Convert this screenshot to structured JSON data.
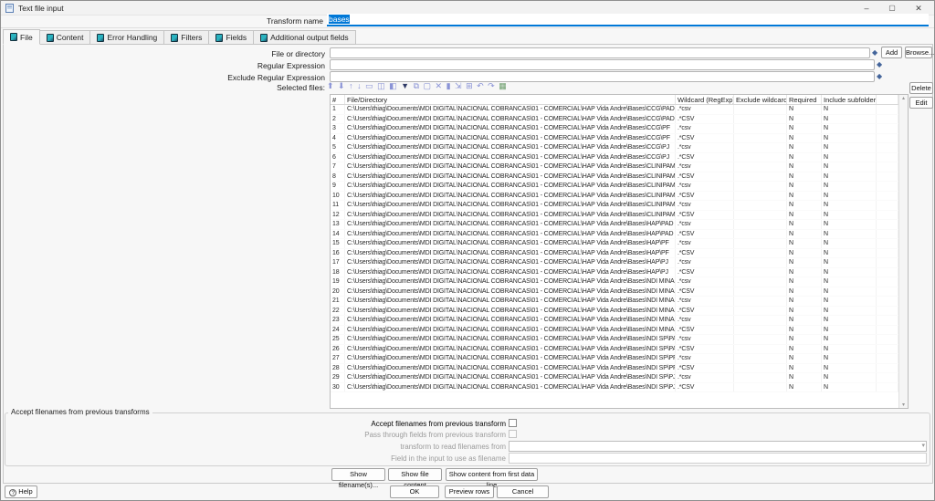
{
  "window": {
    "title": "Text file input",
    "minimize_glyph": "–",
    "maximize_glyph": "▢",
    "close_glyph": "✕"
  },
  "header": {
    "transform_name_label": "Transform name",
    "transform_name_value": "bases"
  },
  "tabs": [
    {
      "label": "File",
      "active": true
    },
    {
      "label": "Content",
      "active": false
    },
    {
      "label": "Error Handling",
      "active": false
    },
    {
      "label": "Filters",
      "active": false
    },
    {
      "label": "Fields",
      "active": false
    },
    {
      "label": "Additional output fields",
      "active": false
    }
  ],
  "file_tab": {
    "file_or_directory_label": "File or directory",
    "regular_expression_label": "Regular Expression",
    "exclude_regular_expression_label": "Exclude Regular Expression",
    "selected_files_label": "Selected files:",
    "add_button": "Add",
    "browse_button": "Browse...",
    "delete_button": "Delete",
    "edit_button": "Edit"
  },
  "toolbar": {
    "icons": [
      {
        "name": "sort-ascending-icon",
        "glyph": "⬆"
      },
      {
        "name": "sort-descending-icon",
        "glyph": "⬇"
      },
      {
        "name": "move-rows-up-icon",
        "glyph": "↑"
      },
      {
        "name": "move-rows-down-icon",
        "glyph": "↓"
      },
      {
        "name": "clear-rows-icon",
        "glyph": "▭"
      },
      {
        "name": "optimal-width-with-header-icon",
        "glyph": "◫"
      },
      {
        "name": "optimal-width-without-header-icon",
        "glyph": "◧"
      },
      {
        "name": "filter-rows-icon",
        "glyph": "▼",
        "color": "#2f3a66"
      },
      {
        "name": "copy-rows-icon",
        "glyph": "⧉"
      },
      {
        "name": "paste-rows-icon",
        "glyph": "▢"
      },
      {
        "name": "cut-rows-icon",
        "glyph": "✕"
      },
      {
        "name": "delete-rows-icon",
        "glyph": "▮"
      },
      {
        "name": "keep-selected-rows-icon",
        "glyph": "⇲"
      },
      {
        "name": "copy-field-to-all-rows-icon",
        "glyph": "⊞"
      },
      {
        "name": "undo-icon",
        "glyph": "↶"
      },
      {
        "name": "redo-icon",
        "glyph": "↷"
      },
      {
        "name": "edit-row-icon",
        "glyph": "▦",
        "color": "#6f9f6f"
      }
    ]
  },
  "table": {
    "columns": [
      "#",
      "File/Directory",
      "Wildcard (RegExp)",
      "Exclude wildcard",
      "Required",
      "Include subfolders"
    ],
    "rows": [
      [
        1,
        "C:\\Users\\thiag\\Documents\\MDI DIGITAL\\NACIONAL COBRANCAS\\01 - COMERCIAL\\HAP Vida Andre\\Bases\\CCG\\PAD",
        ".*csv",
        "",
        "N",
        "N"
      ],
      [
        2,
        "C:\\Users\\thiag\\Documents\\MDI DIGITAL\\NACIONAL COBRANCAS\\01 - COMERCIAL\\HAP Vida Andre\\Bases\\CCG\\PAD",
        ".*CSV",
        "",
        "N",
        "N"
      ],
      [
        3,
        "C:\\Users\\thiag\\Documents\\MDI DIGITAL\\NACIONAL COBRANCAS\\01 - COMERCIAL\\HAP Vida Andre\\Bases\\CCG\\PF",
        ".*csv",
        "",
        "N",
        "N"
      ],
      [
        4,
        "C:\\Users\\thiag\\Documents\\MDI DIGITAL\\NACIONAL COBRANCAS\\01 - COMERCIAL\\HAP Vida Andre\\Bases\\CCG\\PF",
        ".*CSV",
        "",
        "N",
        "N"
      ],
      [
        5,
        "C:\\Users\\thiag\\Documents\\MDI DIGITAL\\NACIONAL COBRANCAS\\01 - COMERCIAL\\HAP Vida Andre\\Bases\\CCG\\PJ",
        ".*csv",
        "",
        "N",
        "N"
      ],
      [
        6,
        "C:\\Users\\thiag\\Documents\\MDI DIGITAL\\NACIONAL COBRANCAS\\01 - COMERCIAL\\HAP Vida Andre\\Bases\\CCG\\PJ",
        ".*CSV",
        "",
        "N",
        "N"
      ],
      [
        7,
        "C:\\Users\\thiag\\Documents\\MDI DIGITAL\\NACIONAL COBRANCAS\\01 - COMERCIAL\\HAP Vida Andre\\Bases\\CLINIPAM\\PAD",
        ".*csv",
        "",
        "N",
        "N"
      ],
      [
        8,
        "C:\\Users\\thiag\\Documents\\MDI DIGITAL\\NACIONAL COBRANCAS\\01 - COMERCIAL\\HAP Vida Andre\\Bases\\CLINIPAM\\PAD",
        ".*CSV",
        "",
        "N",
        "N"
      ],
      [
        9,
        "C:\\Users\\thiag\\Documents\\MDI DIGITAL\\NACIONAL COBRANCAS\\01 - COMERCIAL\\HAP Vida Andre\\Bases\\CLINIPAM\\PF",
        ".*csv",
        "",
        "N",
        "N"
      ],
      [
        10,
        "C:\\Users\\thiag\\Documents\\MDI DIGITAL\\NACIONAL COBRANCAS\\01 - COMERCIAL\\HAP Vida Andre\\Bases\\CLINIPAM\\PF",
        ".*CSV",
        "",
        "N",
        "N"
      ],
      [
        11,
        "C:\\Users\\thiag\\Documents\\MDI DIGITAL\\NACIONAL COBRANCAS\\01 - COMERCIAL\\HAP Vida Andre\\Bases\\CLINIPAM\\PJ",
        ".*csv",
        "",
        "N",
        "N"
      ],
      [
        12,
        "C:\\Users\\thiag\\Documents\\MDI DIGITAL\\NACIONAL COBRANCAS\\01 - COMERCIAL\\HAP Vida Andre\\Bases\\CLINIPAM\\PJ",
        ".*CSV",
        "",
        "N",
        "N"
      ],
      [
        13,
        "C:\\Users\\thiag\\Documents\\MDI DIGITAL\\NACIONAL COBRANCAS\\01 - COMERCIAL\\HAP Vida Andre\\Bases\\HAP\\PAD",
        ".*csv",
        "",
        "N",
        "N"
      ],
      [
        14,
        "C:\\Users\\thiag\\Documents\\MDI DIGITAL\\NACIONAL COBRANCAS\\01 - COMERCIAL\\HAP Vida Andre\\Bases\\HAP\\PAD",
        ".*CSV",
        "",
        "N",
        "N"
      ],
      [
        15,
        "C:\\Users\\thiag\\Documents\\MDI DIGITAL\\NACIONAL COBRANCAS\\01 - COMERCIAL\\HAP Vida Andre\\Bases\\HAP\\PF",
        ".*csv",
        "",
        "N",
        "N"
      ],
      [
        16,
        "C:\\Users\\thiag\\Documents\\MDI DIGITAL\\NACIONAL COBRANCAS\\01 - COMERCIAL\\HAP Vida Andre\\Bases\\HAP\\PF",
        ".*CSV",
        "",
        "N",
        "N"
      ],
      [
        17,
        "C:\\Users\\thiag\\Documents\\MDI DIGITAL\\NACIONAL COBRANCAS\\01 - COMERCIAL\\HAP Vida Andre\\Bases\\HAP\\PJ",
        ".*csv",
        "",
        "N",
        "N"
      ],
      [
        18,
        "C:\\Users\\thiag\\Documents\\MDI DIGITAL\\NACIONAL COBRANCAS\\01 - COMERCIAL\\HAP Vida Andre\\Bases\\HAP\\PJ",
        ".*CSV",
        "",
        "N",
        "N"
      ],
      [
        19,
        "C:\\Users\\thiag\\Documents\\MDI DIGITAL\\NACIONAL COBRANCAS\\01 - COMERCIAL\\HAP Vida Andre\\Bases\\NDI MINAS\\PAD",
        ".*csv",
        "",
        "N",
        "N"
      ],
      [
        20,
        "C:\\Users\\thiag\\Documents\\MDI DIGITAL\\NACIONAL COBRANCAS\\01 - COMERCIAL\\HAP Vida Andre\\Bases\\NDI MINAS\\PAD",
        ".*CSV",
        "",
        "N",
        "N"
      ],
      [
        21,
        "C:\\Users\\thiag\\Documents\\MDI DIGITAL\\NACIONAL COBRANCAS\\01 - COMERCIAL\\HAP Vida Andre\\Bases\\NDI MINAS\\PF",
        ".*csv",
        "",
        "N",
        "N"
      ],
      [
        22,
        "C:\\Users\\thiag\\Documents\\MDI DIGITAL\\NACIONAL COBRANCAS\\01 - COMERCIAL\\HAP Vida Andre\\Bases\\NDI MINAS\\PF",
        ".*CSV",
        "",
        "N",
        "N"
      ],
      [
        23,
        "C:\\Users\\thiag\\Documents\\MDI DIGITAL\\NACIONAL COBRANCAS\\01 - COMERCIAL\\HAP Vida Andre\\Bases\\NDI MINAS\\PJ",
        ".*csv",
        "",
        "N",
        "N"
      ],
      [
        24,
        "C:\\Users\\thiag\\Documents\\MDI DIGITAL\\NACIONAL COBRANCAS\\01 - COMERCIAL\\HAP Vida Andre\\Bases\\NDI MINAS\\PJ",
        ".*CSV",
        "",
        "N",
        "N"
      ],
      [
        25,
        "C:\\Users\\thiag\\Documents\\MDI DIGITAL\\NACIONAL COBRANCAS\\01 - COMERCIAL\\HAP Vida Andre\\Bases\\NDI SP\\PAD",
        ".*csv",
        "",
        "N",
        "N"
      ],
      [
        26,
        "C:\\Users\\thiag\\Documents\\MDI DIGITAL\\NACIONAL COBRANCAS\\01 - COMERCIAL\\HAP Vida Andre\\Bases\\NDI SP\\PAD",
        ".*CSV",
        "",
        "N",
        "N"
      ],
      [
        27,
        "C:\\Users\\thiag\\Documents\\MDI DIGITAL\\NACIONAL COBRANCAS\\01 - COMERCIAL\\HAP Vida Andre\\Bases\\NDI SP\\PF",
        ".*csv",
        "",
        "N",
        "N"
      ],
      [
        28,
        "C:\\Users\\thiag\\Documents\\MDI DIGITAL\\NACIONAL COBRANCAS\\01 - COMERCIAL\\HAP Vida Andre\\Bases\\NDI SP\\PF",
        ".*CSV",
        "",
        "N",
        "N"
      ],
      [
        29,
        "C:\\Users\\thiag\\Documents\\MDI DIGITAL\\NACIONAL COBRANCAS\\01 - COMERCIAL\\HAP Vida Andre\\Bases\\NDI SP\\PJ",
        ".*csv",
        "",
        "N",
        "N"
      ],
      [
        30,
        "C:\\Users\\thiag\\Documents\\MDI DIGITAL\\NACIONAL COBRANCAS\\01 - COMERCIAL\\HAP Vida Andre\\Bases\\NDI SP\\PJ",
        ".*CSV",
        "",
        "N",
        "N"
      ]
    ]
  },
  "accept_group": {
    "legend": "Accept filenames from previous transforms",
    "accept_label": "Accept filenames from previous transform",
    "pass_through_label": "Pass through fields from previous transform",
    "transform_read_label": "transform to read filenames from",
    "field_input_label": "Field in the input to use as filename"
  },
  "footer": {
    "show_filenames_button": "Show filename(s)...",
    "show_file_content_button": "Show file content",
    "show_first_line_button": "Show content from first data line",
    "help_button": "Help",
    "ok_button": "OK",
    "preview_rows_button": "Preview rows",
    "cancel_button": "Cancel"
  },
  "colors": {
    "selection": "#0078d7",
    "focus_underline": "#0078d7",
    "tab_icon_teal": "#2bb3c0",
    "toolbar_icon": "#8a93d6",
    "filter_icon": "#2f3a66",
    "variable_diamond": "#44659b"
  }
}
